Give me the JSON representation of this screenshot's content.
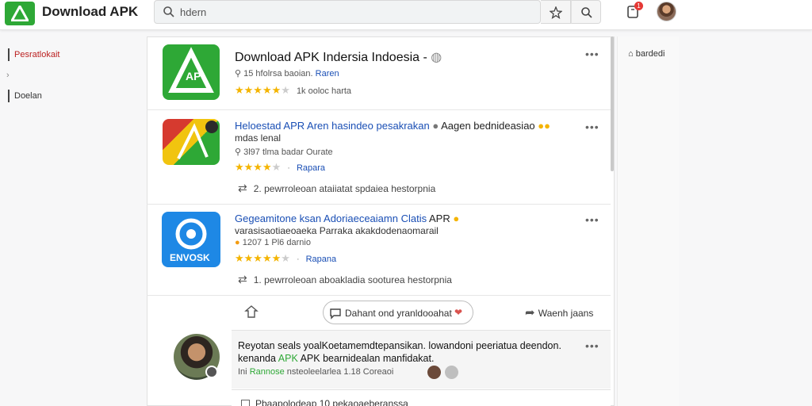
{
  "header": {
    "brand": "Download APK",
    "search_value": "hdern",
    "notif_count": "1"
  },
  "sidebar": {
    "items": [
      {
        "label": "Pesratlokait"
      },
      {
        "label": "Doelan"
      }
    ]
  },
  "right_panel": {
    "item": "bardedi"
  },
  "feed": {
    "card1": {
      "title": "Download APK Indersia Indoesia -",
      "meta_prefix": "15 hfolrsa baoian.",
      "meta_link": "Raren",
      "rating_text": "1k ooloc harta",
      "stars": 4.5
    },
    "card2": {
      "title_blue": "Heloestad APR Aren hasindeo pesakrakan",
      "title_rest": "Aagen bednideasiao",
      "line2": "mdas lenal",
      "meta": "3l97 tlma badar Ourate",
      "rating_text": "Rapara",
      "stars": 4.5,
      "share_count": "2.",
      "share_text": "pewrroleoan ataiiatat spdaiea hestorpnia"
    },
    "card3": {
      "title_blue": "Gegeamitone ksan Adoriaeceaiamn Clatis",
      "title_rest": "APR",
      "line2": "varasisaotiaeoaeka Parraka akakdodenaomarail",
      "meta": "1207 1 Pl6 darnio",
      "rating_text": "Rapana",
      "stars": 4.5,
      "share_count": "1.",
      "share_text": "pewrroleoan aboakladia sooturea hestorpnia"
    },
    "actions": {
      "pill": "Dahant ond yranldooahat",
      "right": "Waenh jaans"
    },
    "comment": {
      "line1": "Reyotan seals yoalKoetamemdtepansikan. lowandoni peeriatua deendon.",
      "line2_prefix": "kenanda",
      "line2_link": "APK",
      "line2_rest": "APK bearnidealan manfidakat.",
      "meta_prefix": "Ini",
      "meta_link": "Rannose",
      "meta_rest": "nsteoleelarlea 1.18 Coreaoi"
    },
    "bottom": {
      "text": "Pbaapolodeap 10 pekaoaeberanssa"
    }
  },
  "colors": {
    "accent_green": "#2ea836",
    "link_blue": "#1a4fb5",
    "star_gold": "#f4b400"
  }
}
